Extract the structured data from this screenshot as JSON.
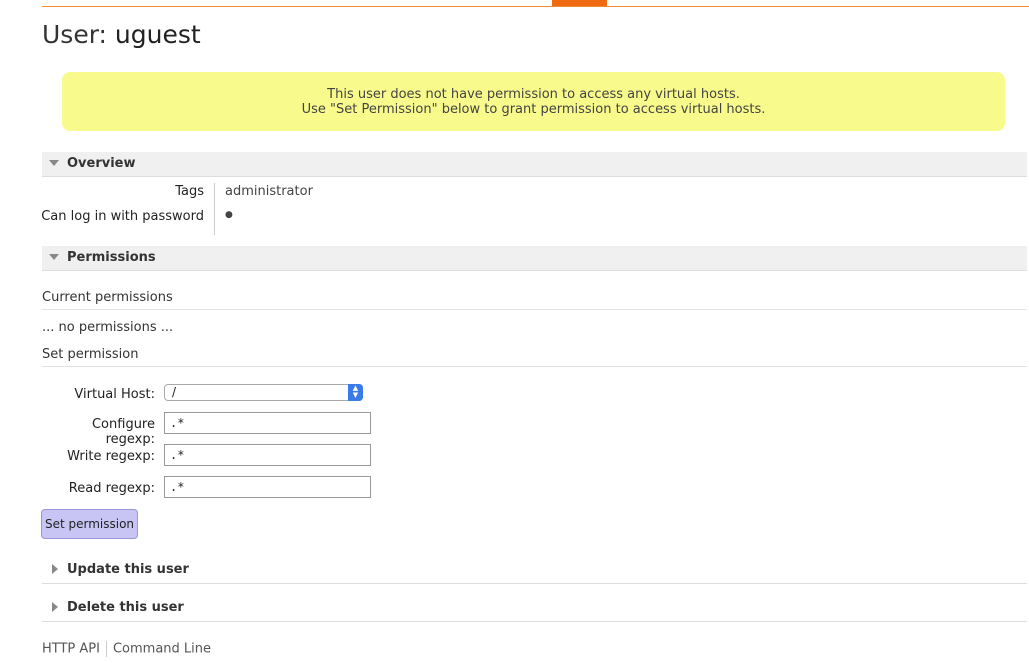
{
  "page": {
    "title_prefix": "User:",
    "title_name": "uguest"
  },
  "warning": {
    "line1": "This user does not have permission to access any virtual hosts.",
    "line2": "Use \"Set Permission\" below to grant permission to access virtual hosts."
  },
  "overview": {
    "title": "Overview",
    "rows": [
      {
        "label": "Tags",
        "value": "administrator"
      },
      {
        "label": "Can log in with password",
        "value": "●"
      }
    ]
  },
  "permissions": {
    "title": "Permissions",
    "current_heading": "Current permissions",
    "current_empty": "... no permissions ...",
    "set_heading": "Set permission",
    "vhost_label": "Virtual Host:",
    "vhost_value": "/",
    "configure_label": "Configure regexp:",
    "configure_value": ".*",
    "write_label": "Write regexp:",
    "write_value": ".*",
    "read_label": "Read regexp:",
    "read_value": ".*",
    "submit_label": "Set permission"
  },
  "update_section": {
    "title": "Update this user"
  },
  "delete_section": {
    "title": "Delete this user"
  },
  "footer": {
    "link1": "HTTP API",
    "link2": "Command Line"
  },
  "colors": {
    "accent": "#f06a12",
    "warning_bg": "#f9fa8c",
    "button_bg": "#c8c5f5"
  }
}
